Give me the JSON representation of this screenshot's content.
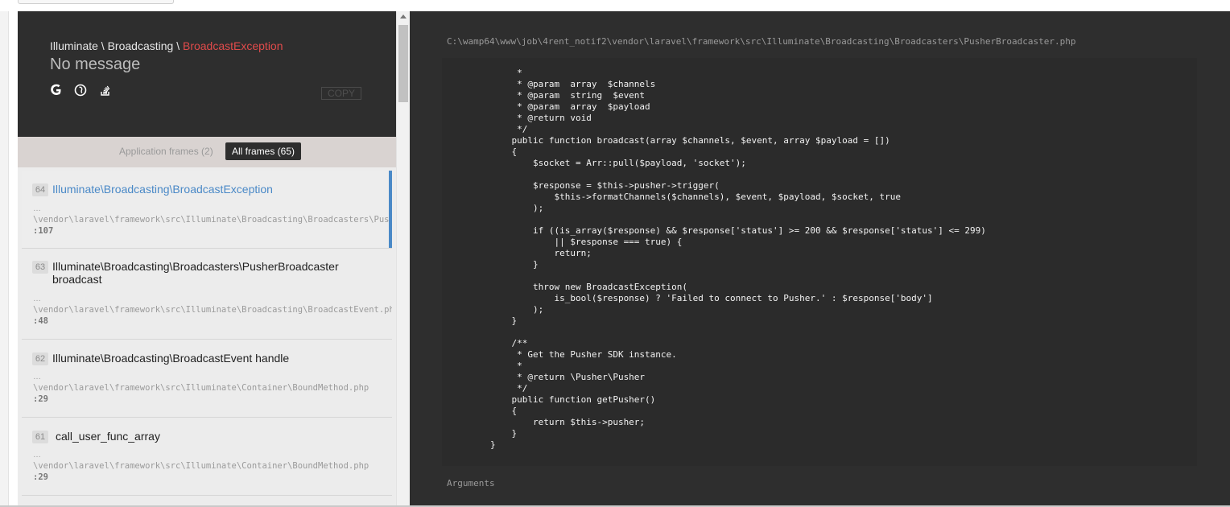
{
  "exception": {
    "namespace_1": "Illuminate",
    "sep": " \\ ",
    "namespace_2": "Broadcasting",
    "name": "BroadcastException",
    "message": "No message",
    "copy_label": "COPY"
  },
  "icons": [
    "google-icon",
    "duckduckgo-icon",
    "stackoverflow-icon"
  ],
  "filters": {
    "application": "Application frames (2)",
    "all": "All frames (65)"
  },
  "frames": [
    {
      "index": "64",
      "class": "Illuminate\\Broadcasting\\BroadcastException",
      "method": "",
      "ellipsis": "…",
      "file": "\\vendor\\laravel\\framework\\src\\Illuminate\\Broadcasting\\Broadcasters\\PusherBroadcaster.php",
      "line": ":107"
    },
    {
      "index": "63",
      "class": "Illuminate\\Broadcasting\\Broadcasters\\PusherBroadcaster",
      "method": "broadcast",
      "ellipsis": "…",
      "file": "\\vendor\\laravel\\framework\\src\\Illuminate\\Broadcasting\\BroadcastEvent.php",
      "line": ":48"
    },
    {
      "index": "62",
      "class": "Illuminate\\Broadcasting\\BroadcastEvent handle",
      "method": "",
      "ellipsis": "…",
      "file": "\\vendor\\laravel\\framework\\src\\Illuminate\\Container\\BoundMethod.php",
      "line": ":29"
    },
    {
      "index": "61",
      "class": "call_user_func_array",
      "method": "",
      "ellipsis": "…",
      "file": "\\vendor\\laravel\\framework\\src\\Illuminate\\Container\\BoundMethod.php",
      "line": ":29"
    }
  ],
  "code_view": {
    "file_path": "C:\\wamp64\\www\\job\\4rent_notif2\\vendor\\laravel\\framework\\src\\Illuminate\\Broadcasting\\Broadcasters\\PusherBroadcaster.php",
    "code": "     *\n     * @param  array  $channels\n     * @param  string  $event\n     * @param  array  $payload\n     * @return void\n     */\n    public function broadcast(array $channels, $event, array $payload = [])\n    {\n        $socket = Arr::pull($payload, 'socket');\n\n        $response = $this->pusher->trigger(\n            $this->formatChannels($channels), $event, $payload, $socket, true\n        );\n\n        if ((is_array($response) && $response['status'] >= 200 && $response['status'] <= 299)\n            || $response === true) {\n            return;\n        }\n\n        throw new BroadcastException(\n            is_bool($response) ? 'Failed to connect to Pusher.' : $response['body']\n        );\n    }\n\n    /**\n     * Get the Pusher SDK instance.\n     *\n     * @return \\Pusher\\Pusher\n     */\n    public function getPusher()\n    {\n        return $this->pusher;\n    }\n}",
    "arguments_label": "Arguments"
  }
}
